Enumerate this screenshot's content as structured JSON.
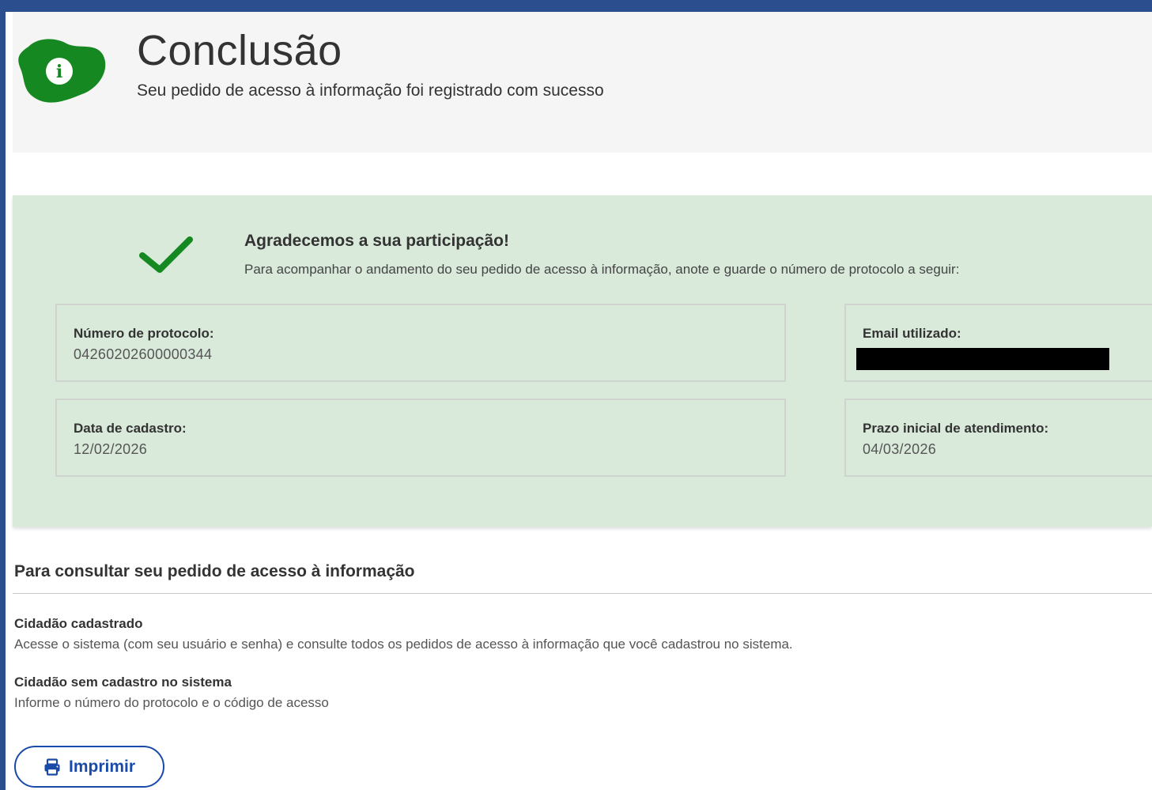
{
  "colors": {
    "frame": "#2b4f8e",
    "header_bg": "#f5f5f5",
    "success_bg": "#d9eadb",
    "brand_green": "#168821",
    "button_blue": "#1a4aa8"
  },
  "header": {
    "icon": "info-icon",
    "title": "Conclusão",
    "subtitle": "Seu pedido de acesso à informação foi registrado com sucesso"
  },
  "success": {
    "icon": "checkmark-icon",
    "title": "Agradecemos a sua participação!",
    "message": "Para acompanhar o andamento do seu pedido de acesso à informação, anote e guarde o número de protocolo a seguir:",
    "protocol": {
      "label": "Número de protocolo:",
      "value": "04260202600000344"
    },
    "email": {
      "label": "Email utilizado:"
    },
    "registration_date": {
      "label": "Data de cadastro:",
      "value": "12/02/2026"
    },
    "deadline": {
      "label": "Prazo inicial de atendimento:",
      "value": "04/03/2026"
    }
  },
  "consult": {
    "title": "Para consultar seu pedido de acesso à informação",
    "registered": {
      "label": "Cidadão cadastrado",
      "text": "Acesse o sistema (com seu usuário e senha) e consulte todos os pedidos de acesso à informação que você cadastrou no sistema."
    },
    "unregistered": {
      "label": "Cidadão sem cadastro no sistema",
      "text": "Informe o número do protocolo e o código de acesso"
    }
  },
  "actions": {
    "print_icon": "printer-icon",
    "print_label": "Imprimir"
  }
}
